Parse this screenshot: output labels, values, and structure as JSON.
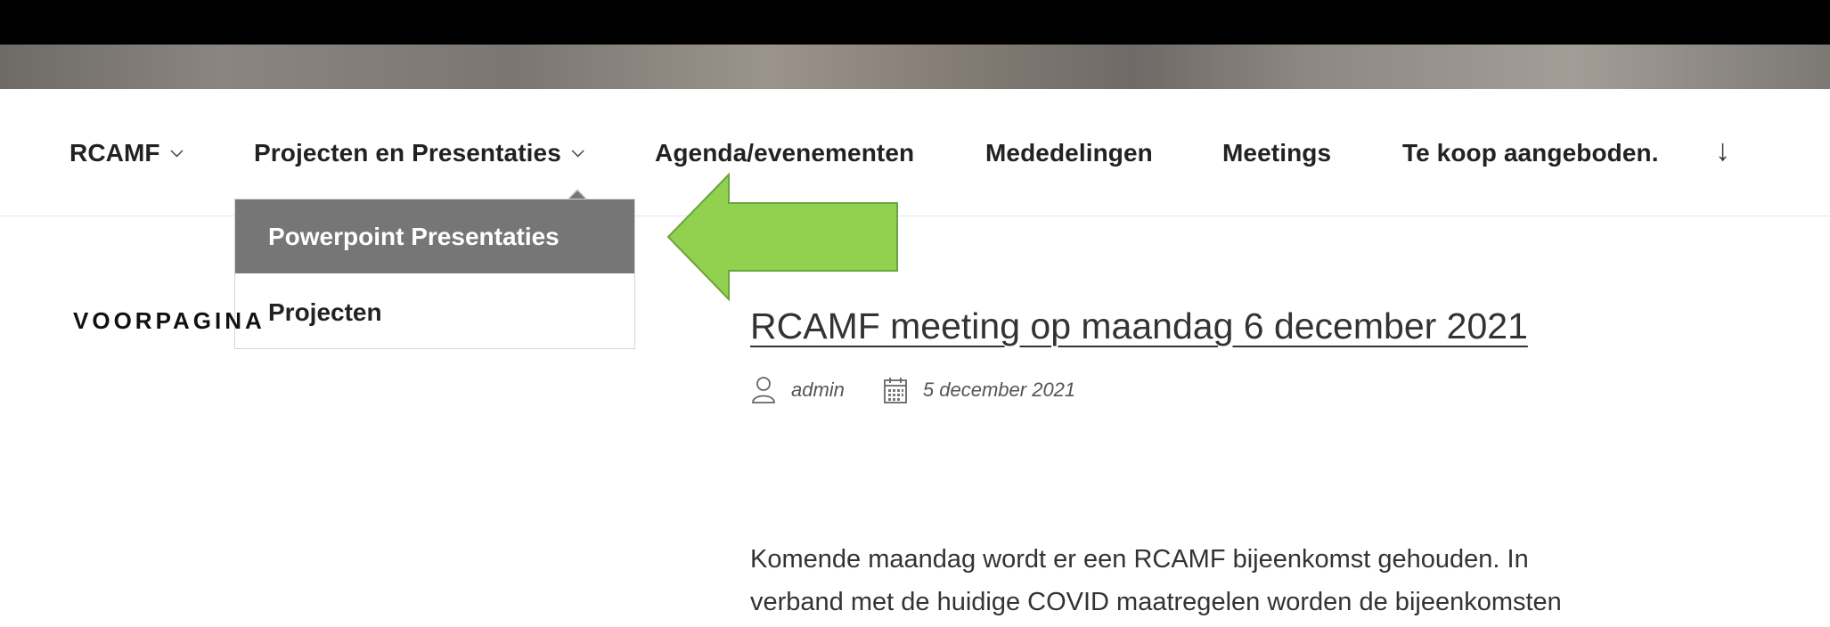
{
  "nav": {
    "items": [
      {
        "label": "RCAMF",
        "has_dropdown": true
      },
      {
        "label": "Projecten en Presentaties",
        "has_dropdown": true
      },
      {
        "label": "Agenda/evenementen",
        "has_dropdown": false
      },
      {
        "label": "Mededelingen",
        "has_dropdown": false
      },
      {
        "label": "Meetings",
        "has_dropdown": false
      },
      {
        "label": "Te koop aangeboden.",
        "has_dropdown": false
      }
    ],
    "scroll_icon": "arrow-down-icon"
  },
  "dropdown": {
    "parent": "Projecten en Presentaties",
    "items": [
      {
        "label": "Powerpoint Presentaties",
        "active": true
      },
      {
        "label": "Projecten",
        "active": false
      }
    ]
  },
  "annotation": {
    "shape": "left-arrow",
    "color": "#92d050"
  },
  "sidebar": {
    "title": "VOORPAGINA"
  },
  "post": {
    "title": "RCAMF meeting op maandag 6 december 2021",
    "author": "admin",
    "date": "5 december 2021",
    "excerpt_lines": [
      "Komende maandag wordt er een RCAMF bijeenkomst gehouden. In",
      "verband met de huidige COVID maatregelen worden de bijeenkomsten"
    ]
  },
  "colors": {
    "dropdown_active_bg": "#767676",
    "text": "#222222",
    "arrow_fill": "#92d050",
    "arrow_stroke": "#6aa43a"
  }
}
